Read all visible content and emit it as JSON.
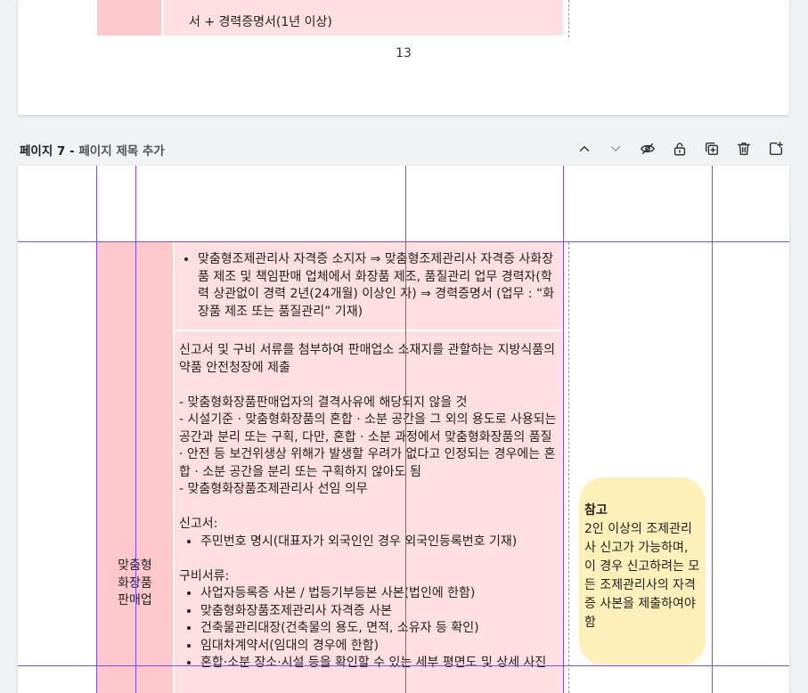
{
  "prev_page": {
    "last_row_text": "서 + 경력증명서(1년 이상)",
    "page_number": "13"
  },
  "page_header": {
    "page_label": "페이지 7",
    "separator": " - ",
    "title_placeholder": "페이지 제목 추가"
  },
  "toolbar": [
    {
      "name": "move-up-icon"
    },
    {
      "name": "move-down-icon"
    },
    {
      "name": "hide-page-icon"
    },
    {
      "name": "lock-page-icon"
    },
    {
      "name": "duplicate-page-icon"
    },
    {
      "name": "delete-page-icon"
    },
    {
      "name": "add-page-icon"
    }
  ],
  "table": {
    "category": "맞춤형\n화장품\n판매업",
    "row1": {
      "bullet": "맞춤형조제관리사 자격증 소지자 ⇒ 맞춤형조제관리사 자격증 사화장품 제조 및 책임판매 업체에서 화장품 제조, 품질관리 업무 경력자(학력 상관없이 경력 2년(24개월) 이상인 자) ⇒ 경력증명서 (업무 : “화장품 제조 또는 품질관리” 기재)"
    },
    "row2": {
      "intro": "신고서 및 구비 서류를 첨부하여 판매업소 소재지를 관할하는 지방식품의약품 안전청장에 제출",
      "requirements": [
        "- 맞춤형화장품판매업자의 결격사유에 해당되지 않을 것",
        "- 시설기준 · 맞춤형화장품의 혼합 · 소분 공간을 그 외의 용도로 사용되는 공간과 분리 또는 구획, 다만, 혼합 · 소분 과정에서 맞춤형화장품의 품질 · 안전 등 보건위생상 위해가 발생할 우려가 없다고 인정되는 경우에는 혼합 · 소분 공간을 분리 또는 구획하지 않아도 됨",
        "- 맞춤형화장품조제관리사 선임 의무"
      ],
      "form_label": "신고서:",
      "form_items": [
        "주민번호 명시(대표자가 외국인인 경우 외국인등록번호 기재)"
      ],
      "docs_label": "구비서류:",
      "docs_items": [
        "사업자등록증 사본 / 법등기부등본 사본(법인에 한함)",
        "맞춤형화장품조제관리사 자격증 사본",
        "건축물관리대장(건축물의 용도, 면적, 소유자 등 확인)",
        "임대차계약서(임대의 경우에 한함)",
        "혼합·소분 장소·시설 등을 확인할 수 있는 세부 평면도 및 상세 사진"
      ]
    },
    "note": {
      "title": "참고",
      "text": " 2인 이상의 조제관리사 신고가 가능하며, 이 경우 신고하려는 모든 조제관리사의 자격증 사본을 제출하여야 함"
    }
  },
  "colors": {
    "pink_light": "#ffdfe2",
    "pink_dark": "#ffc9cc",
    "note_yellow": "#fdf0b8",
    "guide_purple": "#7c4dff"
  }
}
